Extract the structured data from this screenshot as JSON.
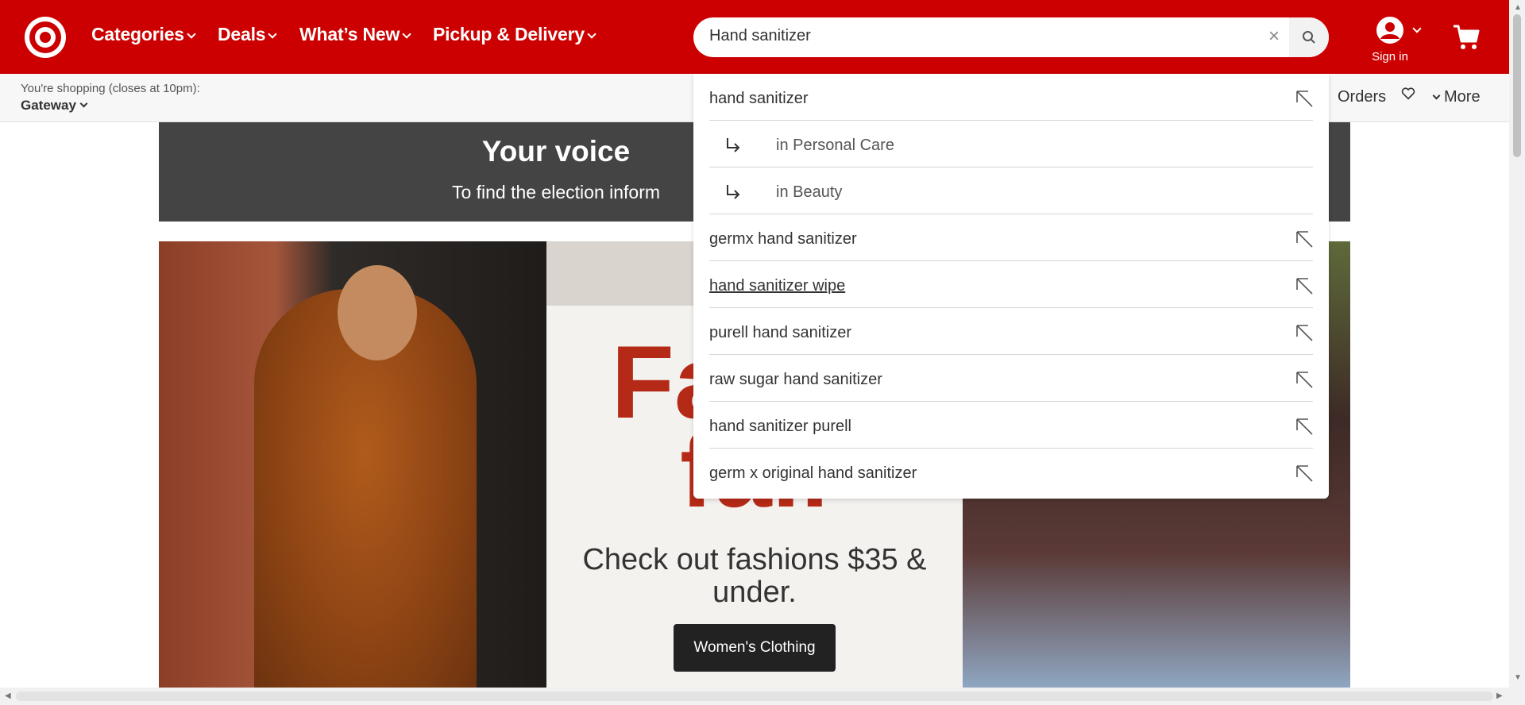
{
  "header": {
    "brand_color": "#cc0000",
    "nav": [
      {
        "label": "Categories"
      },
      {
        "label": "Deals"
      },
      {
        "label": "What’s New"
      },
      {
        "label": "Pickup & Delivery"
      }
    ],
    "search": {
      "value": "Hand sanitizer",
      "placeholder": "Search"
    },
    "account": {
      "label": "Sign in"
    }
  },
  "subheader": {
    "shopping_line": "You're shopping (closes at 10pm):",
    "store_name": "Gateway",
    "links": {
      "orders": "Orders",
      "more": "More"
    }
  },
  "banner": {
    "title": "Your voice",
    "subtitle": "To find the election inform"
  },
  "hero": {
    "big_text": "Fa for fall",
    "copy": "Check out fashions $35 & under.",
    "button_label": "Women's Clothing"
  },
  "suggestions": [
    {
      "text": "hand sanitizer",
      "type": "query"
    },
    {
      "text": "in Personal Care",
      "type": "category"
    },
    {
      "text": "in Beauty",
      "type": "category"
    },
    {
      "text": "germx hand sanitizer",
      "type": "query"
    },
    {
      "text": "hand sanitizer wipe",
      "type": "query",
      "hovered": true
    },
    {
      "text": "purell hand sanitizer",
      "type": "query"
    },
    {
      "text": "raw sugar hand sanitizer",
      "type": "query"
    },
    {
      "text": "hand sanitizer purell",
      "type": "query"
    },
    {
      "text": "germ x original hand sanitizer",
      "type": "query"
    }
  ]
}
